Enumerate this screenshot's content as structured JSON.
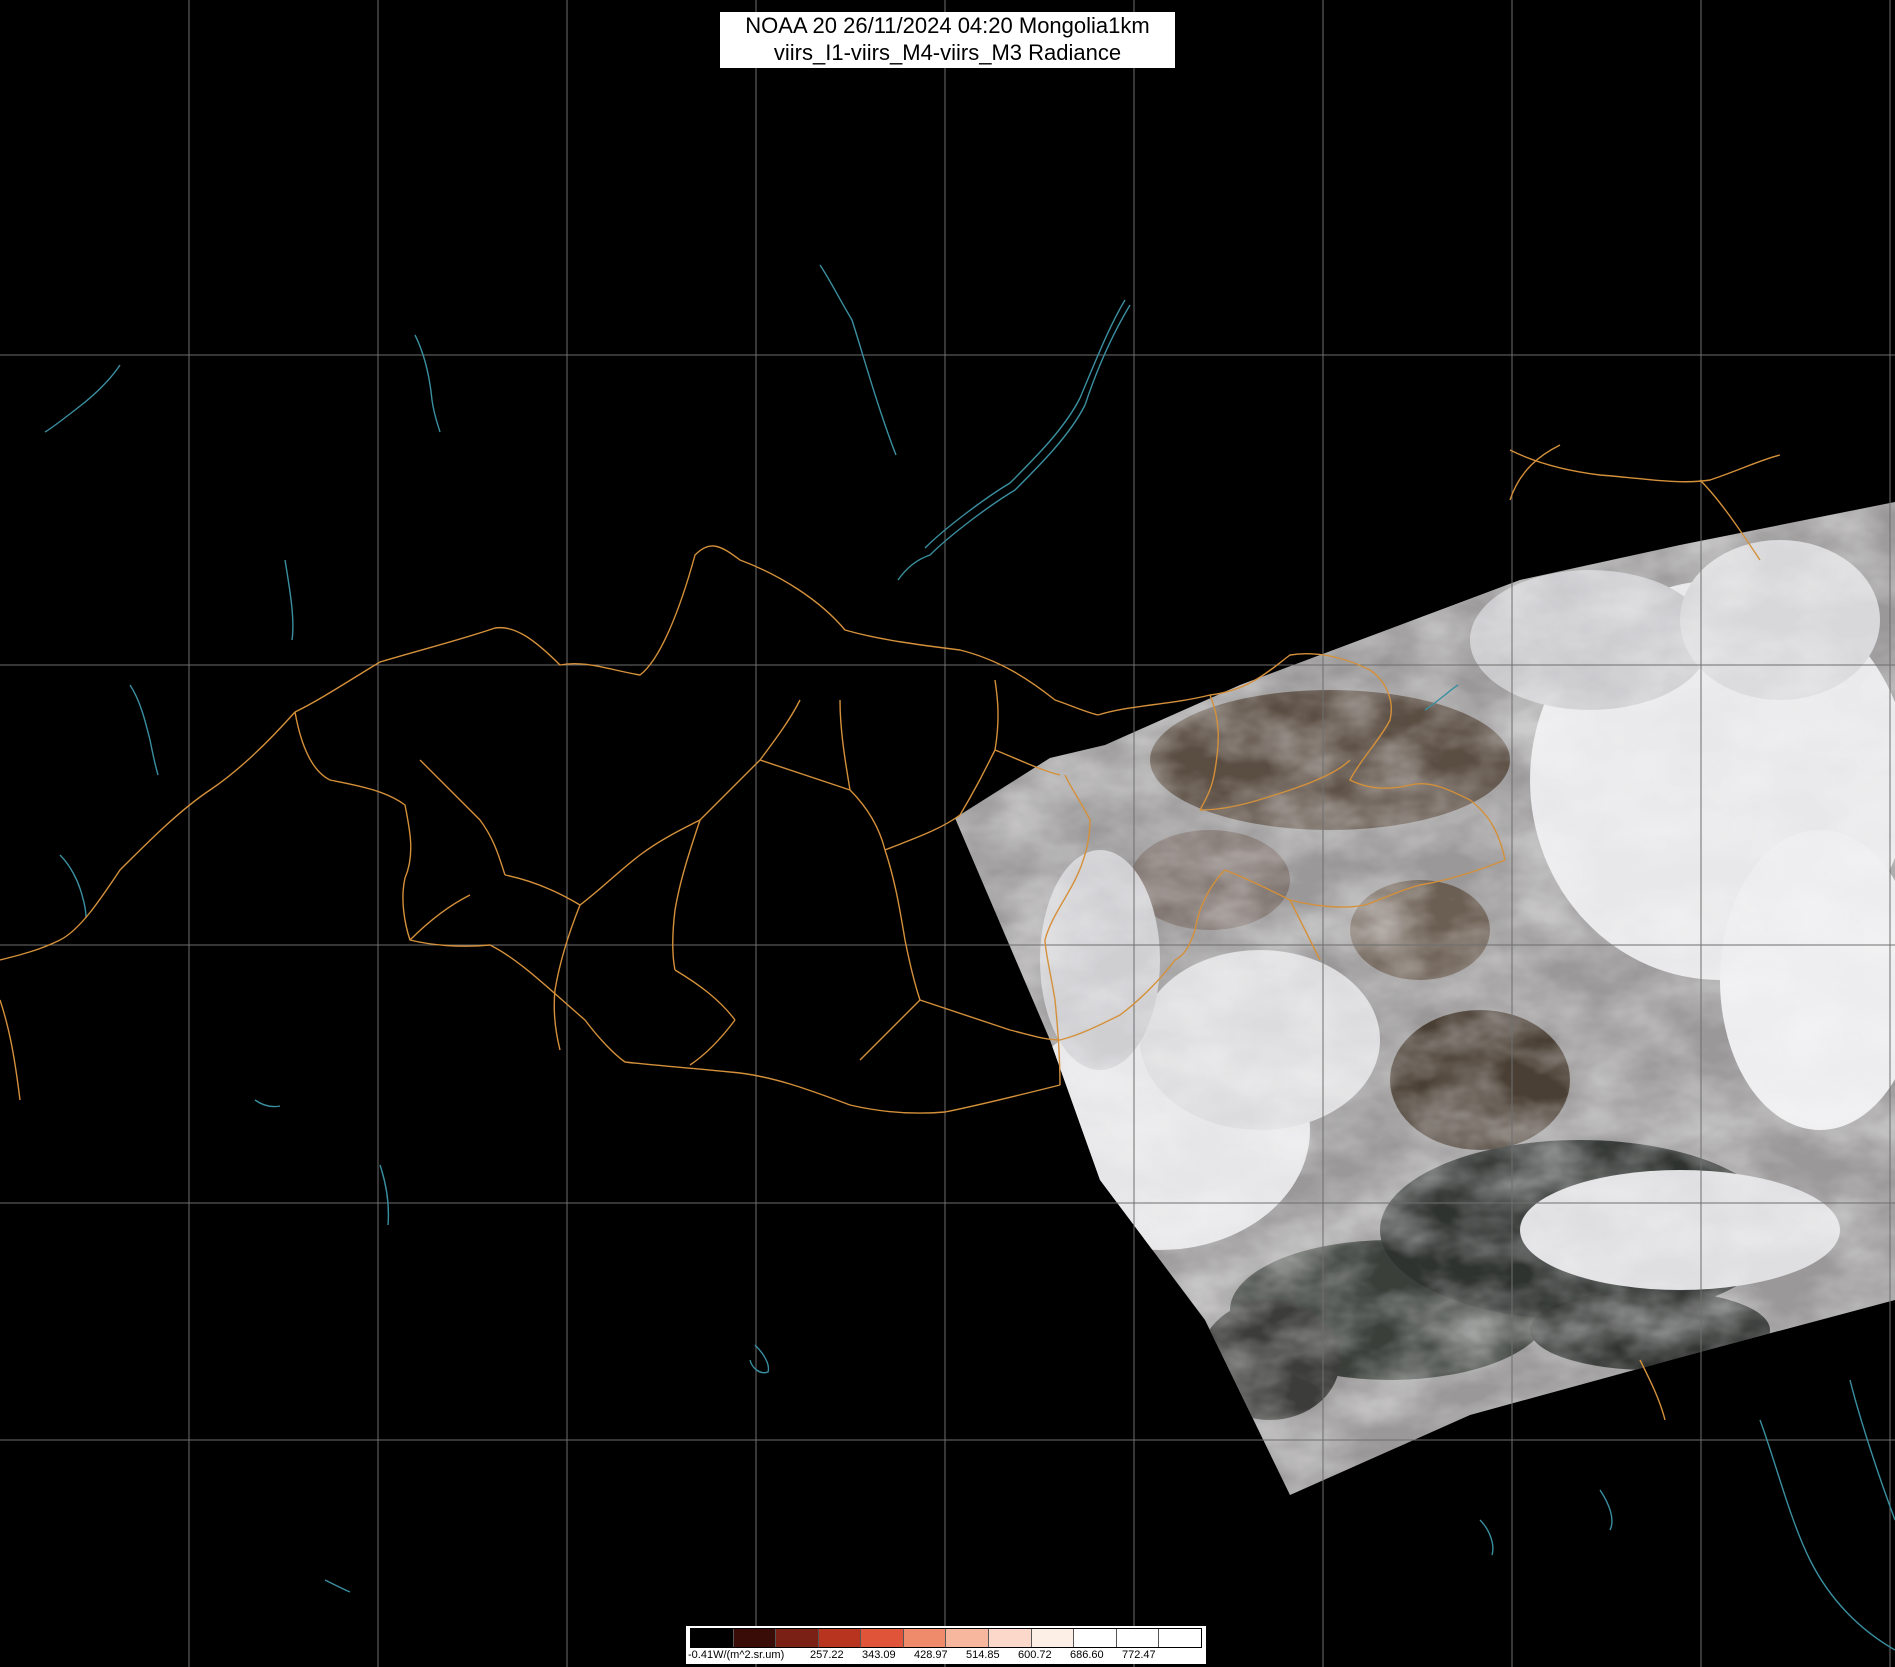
{
  "title": {
    "line1": "NOAA 20 26/11/2024 04:20 Mongolia1km",
    "line2": "viirs_I1-viirs_M4-viirs_M3 Radiance"
  },
  "colorbar": {
    "unit_label": "-0.41W/(m^2.sr.um)",
    "ticks": [
      "257.22",
      "343.09",
      "428.97",
      "514.85",
      "600.72",
      "686.60",
      "772.47"
    ],
    "colors": [
      "#000000",
      "#3a0c08",
      "#7a2014",
      "#b8341f",
      "#e0553a",
      "#ef8a6a",
      "#f7b79f",
      "#fbd8c9",
      "#fdeee6",
      "#ffffff",
      "#ffffff",
      "#ffffff"
    ]
  },
  "colors": {
    "background": "#000000",
    "grid": "#6e6e6e",
    "borders": "#d4903a",
    "coastline": "#3a8fa0",
    "cloud": "#e6e6e8"
  }
}
